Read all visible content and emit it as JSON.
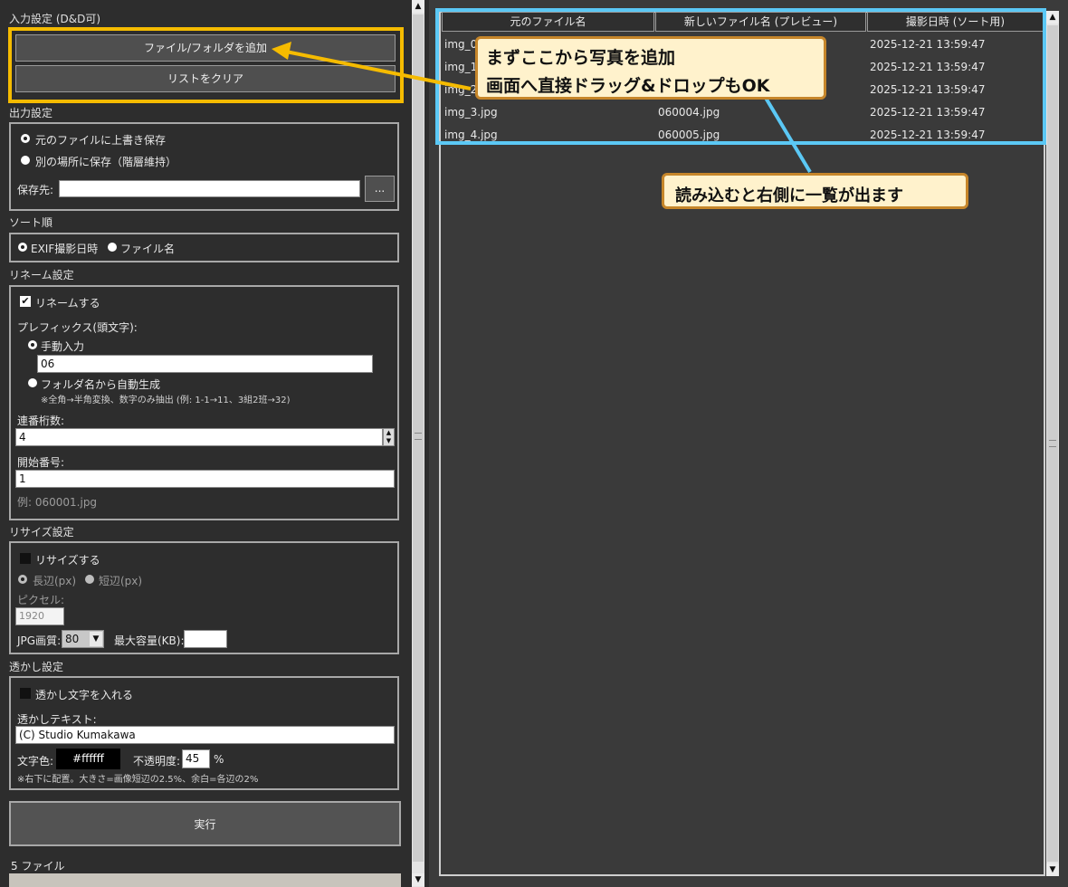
{
  "input_section": {
    "title": "入力設定 (D&D可)",
    "add_button": "ファイル/フォルダを追加",
    "clear_button": "リストをクリア"
  },
  "output_section": {
    "title": "出力設定",
    "overwrite_label": "元のファイルに上書き保存",
    "other_location_label": "別の場所に保存（階層維持）",
    "dest_label": "保存先:",
    "dest_value": "",
    "browse_button": "..."
  },
  "sort_section": {
    "title": "ソート順",
    "exif_label": "EXIF撮影日時",
    "filename_label": "ファイル名"
  },
  "rename_section": {
    "title": "リネーム設定",
    "rename_label": "リネームする",
    "prefix_label": "プレフィックス(頭文字):",
    "manual_label": "手動入力",
    "manual_value": "06",
    "auto_label": "フォルダ名から自動生成",
    "auto_note": "※全角→半角変換、数字のみ抽出 (例: 1-1→11、3組2班→32)",
    "digits_label": "連番桁数:",
    "digits_value": "4",
    "start_label": "開始番号:",
    "start_value": "1",
    "example_label": "例: 060001.jpg"
  },
  "resize_section": {
    "title": "リサイズ設定",
    "resize_label": "リサイズする",
    "long_label": "長辺(px)",
    "short_label": "短辺(px)",
    "pixel_label": "ピクセル:",
    "pixel_value": "1920",
    "quality_label": "JPG画質:",
    "quality_value": "80",
    "maxsize_label": "最大容量(KB):",
    "maxsize_value": ""
  },
  "watermark_section": {
    "title": "透かし設定",
    "enable_label": "透かし文字を入れる",
    "text_label": "透かしテキスト:",
    "text_value": "(C) Studio Kumakawa",
    "color_label": "文字色:",
    "color_value": "#ffffff",
    "opacity_label": "不透明度:",
    "opacity_value": "45",
    "opacity_unit": "%",
    "note": "※右下に配置。大きさ=画像短辺の2.5%、余白=各辺の2%"
  },
  "run_button": "実行",
  "file_count": "5 ファイル",
  "table": {
    "headers": [
      "元のファイル名",
      "新しいファイル名 (プレビュー)",
      "撮影日時 (ソート用)"
    ],
    "rows": [
      {
        "original": "img_0",
        "new": "",
        "date": "2025-12-21 13:59:47"
      },
      {
        "original": "img_1",
        "new": "",
        "date": "2025-12-21 13:59:47"
      },
      {
        "original": "img_2",
        "new": "",
        "date": "2025-12-21 13:59:47"
      },
      {
        "original": "img_3.jpg",
        "new": "060004.jpg",
        "date": "2025-12-21 13:59:47"
      },
      {
        "original": "img_4.jpg",
        "new": "060005.jpg",
        "date": "2025-12-21 13:59:47"
      }
    ]
  },
  "annotations": {
    "callout1_line1": "まずここから写真を追加",
    "callout1_line2": "画面へ直接ドラッグ&ドロップもOK",
    "callout2": "読み込むと右側に一覧が出ます"
  },
  "colors": {
    "highlight_yellow": "#f5bb00",
    "highlight_blue": "#5bc8f5",
    "callout_bg": "#fff2cc",
    "callout_border": "#c6862a"
  }
}
